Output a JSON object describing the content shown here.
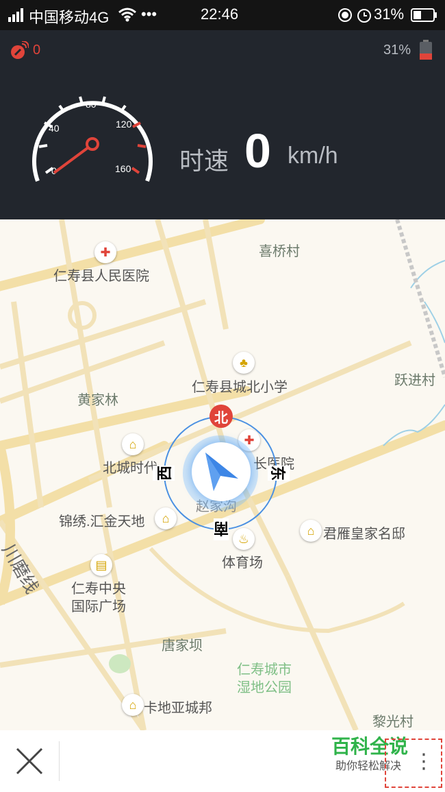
{
  "status_bar": {
    "carrier": "中国移动4G",
    "more": "•••",
    "time": "22:46",
    "battery_percent": "31%"
  },
  "top_bar": {
    "satellite_count": "0",
    "device_battery": "31%",
    "colors": {
      "alert": "#e0443a"
    }
  },
  "speedometer": {
    "gauge_ticks": [
      "0",
      "40",
      "80",
      "120",
      "160"
    ],
    "speed_label": "时速",
    "speed_value": "0",
    "speed_unit": "km/h"
  },
  "map": {
    "labels": {
      "xiqiao_village": "喜桥村",
      "hospital": "仁寿县人民医院",
      "yuejin_village": "跃进村",
      "school": "仁寿县城北小学",
      "huangjialin": "黄家林",
      "beicheng": "北城时代",
      "hospital2": "长医院",
      "zhaojiagou": "赵家沟",
      "jinxiu": "锦绣.汇金天地",
      "junyan": "君雁皇家名邸",
      "stadium": "体育场",
      "sanmo_road": "川磨线",
      "renshou_center_1": "仁寿中央",
      "renshou_center_2": "国际广场",
      "tangjiaba": "唐家坝",
      "wetland_1": "仁寿城市",
      "wetland_2": "湿地公园",
      "kadiya": "卡地亚城邦",
      "liguang": "黎光村"
    },
    "compass": {
      "north": "北",
      "south": "南",
      "east": "东",
      "west": "西"
    },
    "icons": [
      "hospital-icon",
      "school-icon",
      "building-icon",
      "stadium-icon",
      "navigation-arrow-icon"
    ]
  },
  "bottom_bar": {
    "close_symbol": "✕",
    "brand_title": "百科全说",
    "brand_subtitle": "助你轻松解决",
    "more_symbol": "⋮",
    "colors": {
      "brand": "#2fb34a"
    }
  }
}
